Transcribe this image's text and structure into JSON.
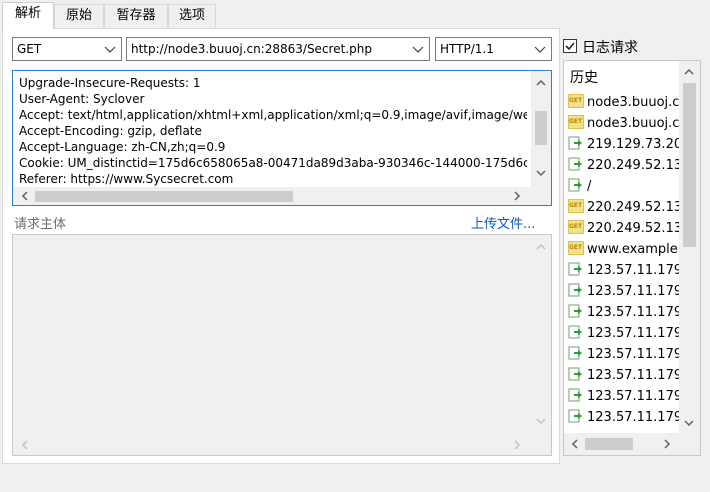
{
  "tabs": [
    "解析",
    "原始",
    "暂存器",
    "选项"
  ],
  "method": {
    "value": "GET"
  },
  "url": {
    "value": "http://node3.buuoj.cn:28863/Secret.php"
  },
  "protocol": {
    "value": "HTTP/1.1"
  },
  "headers": {
    "lines": [
      "Upgrade-Insecure-Requests: 1",
      "User-Agent: Syclover",
      "Accept: text/html,application/xhtml+xml,application/xml;q=0.9,image/avif,image/we",
      "Accept-Encoding: gzip, deflate",
      "Accept-Language: zh-CN,zh;q=0.9",
      "Cookie: UM_distinctid=175d6c658065a8-00471da89d3aba-930346c-144000-175d6c",
      "Referer: https://www.Sycsecret.com"
    ]
  },
  "body_section": {
    "label": "请求主体",
    "upload_link": "上传文件..."
  },
  "log_requests": {
    "label": "日志请求",
    "checked": true
  },
  "history": {
    "title": "历史",
    "items": [
      {
        "icon": "get-icon",
        "text": "node3.buuoj.c"
      },
      {
        "icon": "get-icon",
        "text": "node3.buuoj.c"
      },
      {
        "icon": "request-icon",
        "text": "219.129.73.20"
      },
      {
        "icon": "request-icon",
        "text": "220.249.52.13"
      },
      {
        "icon": "request-icon",
        "text": "/"
      },
      {
        "icon": "get-icon",
        "text": "220.249.52.13"
      },
      {
        "icon": "get-icon",
        "text": "220.249.52.13"
      },
      {
        "icon": "get-icon",
        "text": "www.example."
      },
      {
        "icon": "request-icon",
        "text": "123.57.11.179"
      },
      {
        "icon": "request-icon",
        "text": "123.57.11.179"
      },
      {
        "icon": "request-icon",
        "text": "123.57.11.179"
      },
      {
        "icon": "request-icon",
        "text": "123.57.11.179"
      },
      {
        "icon": "request-icon",
        "text": "123.57.11.179"
      },
      {
        "icon": "request-icon",
        "text": "123.57.11.179"
      },
      {
        "icon": "request-icon",
        "text": "123.57.11.179"
      },
      {
        "icon": "request-icon",
        "text": "123.57.11.179"
      }
    ]
  }
}
